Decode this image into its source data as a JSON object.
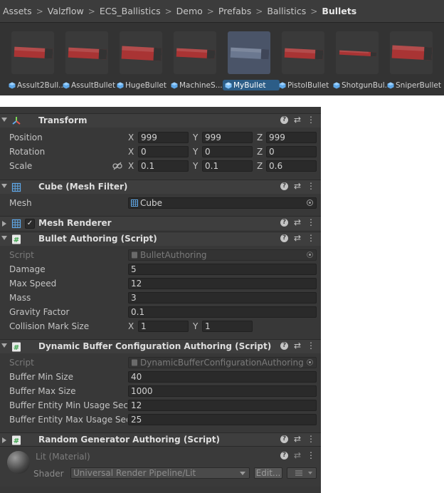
{
  "breadcrumb": [
    "Assets",
    "Valzflow",
    "ECS_Ballistics",
    "Demo",
    "Prefabs",
    "Ballistics",
    "Bullets"
  ],
  "assets": [
    {
      "label": "Assult2Bull..."
    },
    {
      "label": "AssultBullet"
    },
    {
      "label": "HugeBullet"
    },
    {
      "label": "MachineS..."
    },
    {
      "label": "MyBullet",
      "selected": true
    },
    {
      "label": "PistolBullet"
    },
    {
      "label": "ShotgunBul..."
    },
    {
      "label": "SniperBullet"
    }
  ],
  "colors": {
    "bullet_red": "#a93434",
    "selection_blue": "#2c5d87",
    "panel": "#383838"
  },
  "transform": {
    "title": "Transform",
    "position": {
      "label": "Position",
      "x": "999",
      "y": "999",
      "z": "999"
    },
    "rotation": {
      "label": "Rotation",
      "x": "0",
      "y": "0",
      "z": "0"
    },
    "scale": {
      "label": "Scale",
      "x": "0.1",
      "y": "0.1",
      "z": "0.6"
    },
    "axis_x": "X",
    "axis_y": "Y",
    "axis_z": "Z"
  },
  "mesh_filter": {
    "title": "Cube (Mesh Filter)",
    "mesh_label": "Mesh",
    "mesh_value": "Cube"
  },
  "mesh_renderer": {
    "title": "Mesh Renderer",
    "check": "✓"
  },
  "bullet_authoring": {
    "title": "Bullet Authoring (Script)",
    "script_label": "Script",
    "script_value": "BulletAuthoring",
    "damage_label": "Damage",
    "damage": "5",
    "max_speed_label": "Max Speed",
    "max_speed": "12",
    "mass_label": "Mass",
    "mass": "3",
    "gravity_label": "Gravity Factor",
    "gravity": "0.1",
    "collision_label": "Collision Mark Size",
    "collision_x": "1",
    "collision_y": "1"
  },
  "dynamic_buffer": {
    "title": "Dynamic Buffer Configuration Authoring (Script)",
    "script_label": "Script",
    "script_value": "DynamicBufferConfigurationAuthoring",
    "min_size_label": "Buffer Min Size",
    "min_size": "40",
    "max_size_label": "Buffer Max Size",
    "max_size": "1000",
    "entity_min_label": "Buffer Entity Min Usage Seco",
    "entity_min": "12",
    "entity_max_label": "Buffer Entity Max Usage Seco",
    "entity_max": "25"
  },
  "random_generator": {
    "title": "Random Generator Authoring (Script)"
  },
  "material": {
    "title": "Lit (Material)",
    "shader_label": "Shader",
    "shader_value": "Universal Render Pipeline/Lit",
    "edit_label": "Edit..."
  },
  "icons": [
    "transform-icon",
    "grid-icon",
    "script-icon",
    "help-icon",
    "presets-icon",
    "menu-icon",
    "cube-icon",
    "link-icon",
    "object-picker-icon"
  ]
}
